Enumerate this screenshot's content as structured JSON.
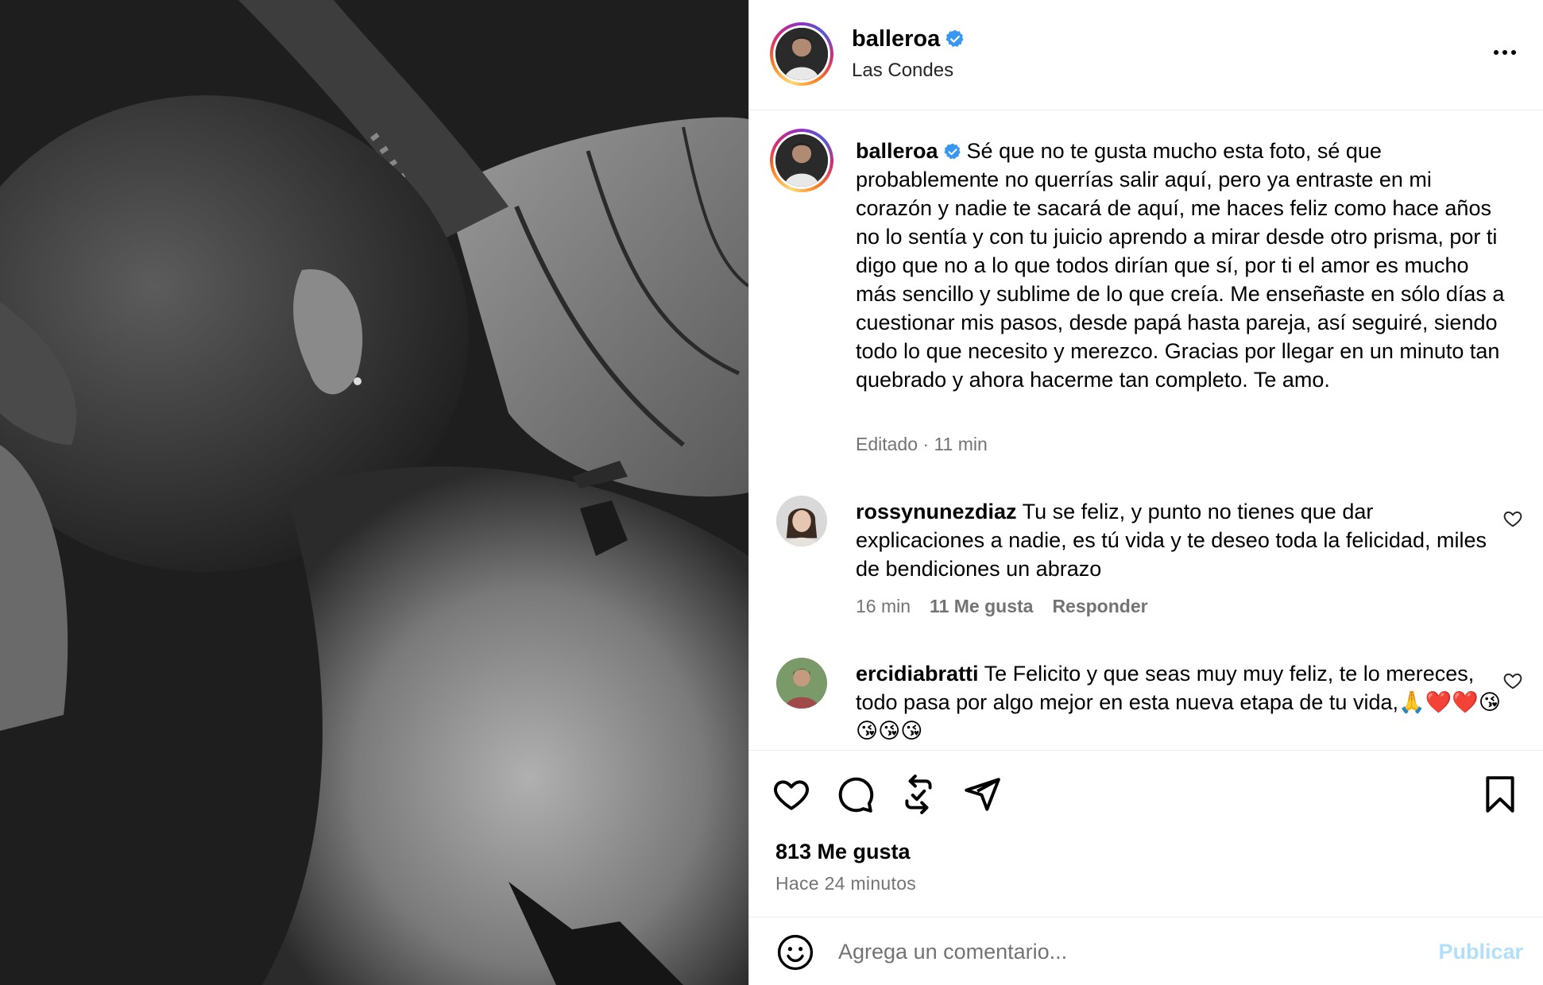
{
  "post": {
    "username": "balleroa",
    "location": "Las Condes",
    "verified": true,
    "caption": "Sé que no te gusta mucho esta foto, sé que probablemente no querrías salir aquí, pero ya entraste en mi corazón y nadie te sacará de aquí, me haces feliz como hace años no lo sentía y con tu juicio aprendo a mirar desde otro prisma, por ti digo que no a lo que todos dirían que sí, por ti el amor es mucho más sencillo y sublime de lo que creía. Me enseñaste en sólo días a cuestionar mis pasos, desde papá hasta pareja, así seguiré, siendo todo lo que necesito y merezco. Gracias por llegar en un minuto tan quebrado y ahora hacerme tan completo. Te amo.",
    "caption_meta": "Editado · 11 min",
    "likes": "813 Me gusta",
    "time_ago": "Hace 24 minutos"
  },
  "comments": [
    {
      "username": "rossynunezdiaz",
      "text": "Tu se feliz, y punto no tienes que dar explicaciones a nadie, es tú vida y te deseo toda la felicidad, miles de bendiciones un abrazo",
      "time": "16 min",
      "likes": "11 Me gusta",
      "reply": "Responder"
    },
    {
      "username": "ercidiabratti",
      "text": "Te Felicito y que seas muy muy feliz, te lo mereces, todo pasa por algo mejor en esta nueva etapa de tu vida,🙏❤️❤️😘😘😘😘"
    }
  ],
  "input": {
    "placeholder": "Agrega un comentario...",
    "post_label": "Publicar"
  },
  "icons": {
    "more": "more-options-icon",
    "verified": "verified-badge-icon",
    "like": "heart-icon",
    "comment": "comment-icon",
    "repost": "repost-icon",
    "share": "share-icon",
    "save": "bookmark-icon",
    "emoji": "emoji-icon"
  },
  "colors": {
    "verified_blue": "#3897f0",
    "muted_text": "#737373",
    "post_button_disabled": "#b2dffc"
  }
}
